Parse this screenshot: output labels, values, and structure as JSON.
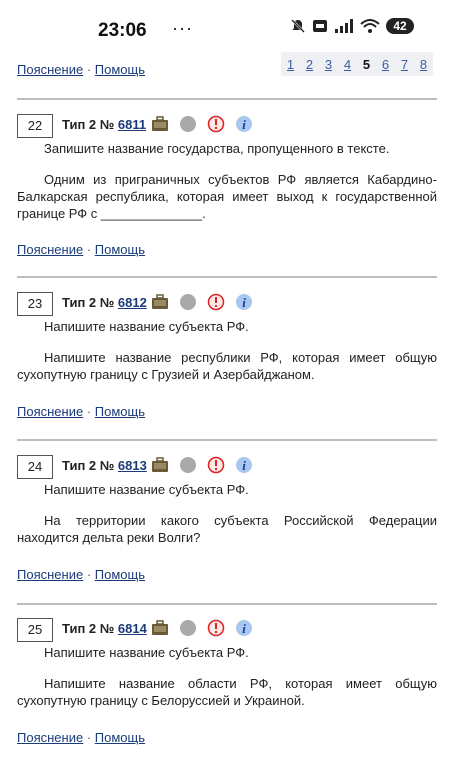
{
  "status": {
    "time": "23:06",
    "dots": "···",
    "battery": "42"
  },
  "top": {
    "explain": "Пояснение",
    "help": "Помощь",
    "sep": "·"
  },
  "pager": [
    "1",
    "2",
    "3",
    "4",
    "5",
    "6",
    "7",
    "8"
  ],
  "pager_current": "5",
  "tasks": [
    {
      "num": "22",
      "type": "Тип 2 №",
      "id": "6811",
      "question": "Запишите название государства, пропущенного в тексте.",
      "body": "Одним из приграничных субъектов РФ является Кабардино-Балкарская республика, которая имеет выход к государственной границе РФ с ______________.",
      "explain": "Пояснение",
      "sep": "·",
      "help": "Помощь"
    },
    {
      "num": "23",
      "type": "Тип 2 №",
      "id": "6812",
      "question": "Напишите название субъекта РФ.",
      "body": "Напишите название республики РФ, которая имеет общую сухопутную границу с Грузией и Азербайджаном.",
      "explain": "Пояснение",
      "sep": "·",
      "help": "Помощь"
    },
    {
      "num": "24",
      "type": "Тип 2 №",
      "id": "6813",
      "question": "Напишите название субъекта РФ.",
      "body": "На территории какого субъекта Российской Федерации находится дельта реки Волги?",
      "explain": "Пояснение",
      "sep": "·",
      "help": "Помощь"
    },
    {
      "num": "25",
      "type": "Тип 2 №",
      "id": "6814",
      "question": "Напишите название субъекта РФ.",
      "body": "Напишите название области РФ, которая имеет общую сухопутную границу с Белоруссией и Украиной.",
      "explain": "Пояснение",
      "sep": "·",
      "help": "Помощь"
    }
  ]
}
